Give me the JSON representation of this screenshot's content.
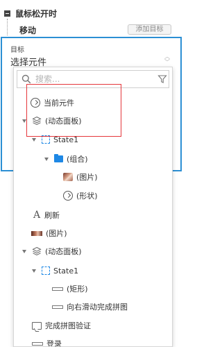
{
  "header": {
    "event_title": "鼠标松开时",
    "case_title": "移动",
    "add_target_label": "添加目标"
  },
  "target": {
    "label": "目标",
    "select_value": "选择元件"
  },
  "search": {
    "placeholder": "搜索..."
  },
  "tree": [
    {
      "label": "当前元件",
      "icon": "circle-arrow-icon"
    },
    {
      "label": "(动态面板)",
      "icon": "layers-icon",
      "expanded": true
    },
    {
      "label": "State1",
      "icon": "dashed-square-icon",
      "expanded": true
    },
    {
      "label": "(组合)",
      "icon": "folder-icon",
      "expanded": true
    },
    {
      "label": "(图片)",
      "icon": "image-thumbnail-icon"
    },
    {
      "label": "(形状)",
      "icon": "circle-arrow-icon"
    },
    {
      "label": "刷新",
      "icon": "text-icon"
    },
    {
      "label": "(图片)",
      "icon": "image-thumbnail-icon"
    },
    {
      "label": "(动态面板)",
      "icon": "layers-icon",
      "expanded": true
    },
    {
      "label": "State1",
      "icon": "dashed-square-icon",
      "expanded": true
    },
    {
      "label": "(矩形)",
      "icon": "rectangle-icon"
    },
    {
      "label": "向右滑动完成拼图",
      "icon": "rectangle-icon"
    },
    {
      "label": "完成拼图验证",
      "icon": "speech-bubble-icon"
    },
    {
      "label": "登录",
      "icon": "rectangle-icon"
    }
  ],
  "colors": {
    "accent_blue": "#2b8fd4",
    "highlight_red": "#e5353a"
  }
}
